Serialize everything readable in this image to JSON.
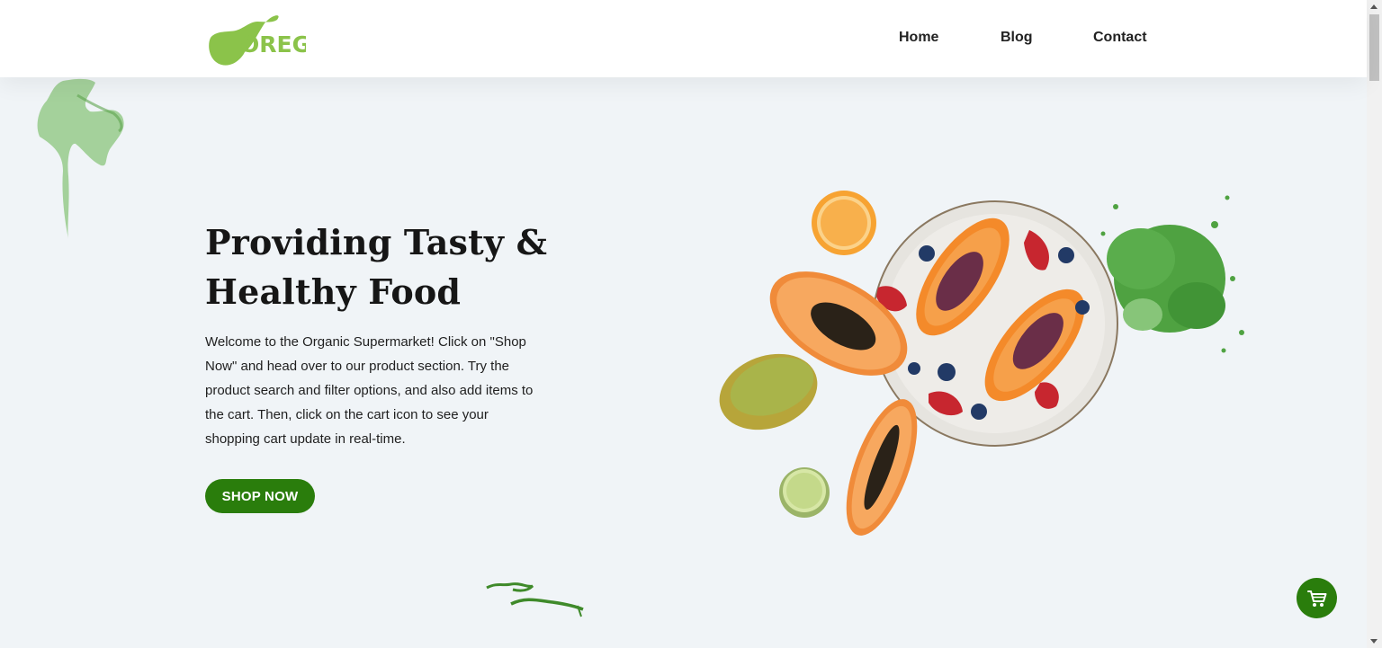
{
  "header": {
    "logo_text": "OREG",
    "nav": [
      {
        "label": "Home"
      },
      {
        "label": "Blog"
      },
      {
        "label": "Contact"
      }
    ]
  },
  "hero": {
    "title": "Providing Tasty & Healthy Food",
    "description": "Welcome to the Organic Supermarket! Click on \"Shop Now\" and head over to our product section. Try the product search and filter options, and also add items to the cart. Then, click on the cart icon to see your shopping cart update in real-time.",
    "cta_label": "SHOP NOW",
    "image_icon": "papaya-fruit-plate-image"
  },
  "cart_button": {
    "icon": "shopping-cart-icon"
  },
  "colors": {
    "accent": "#2a7d0c",
    "logo_green": "#8bc34a",
    "background": "#f0f4f7"
  }
}
